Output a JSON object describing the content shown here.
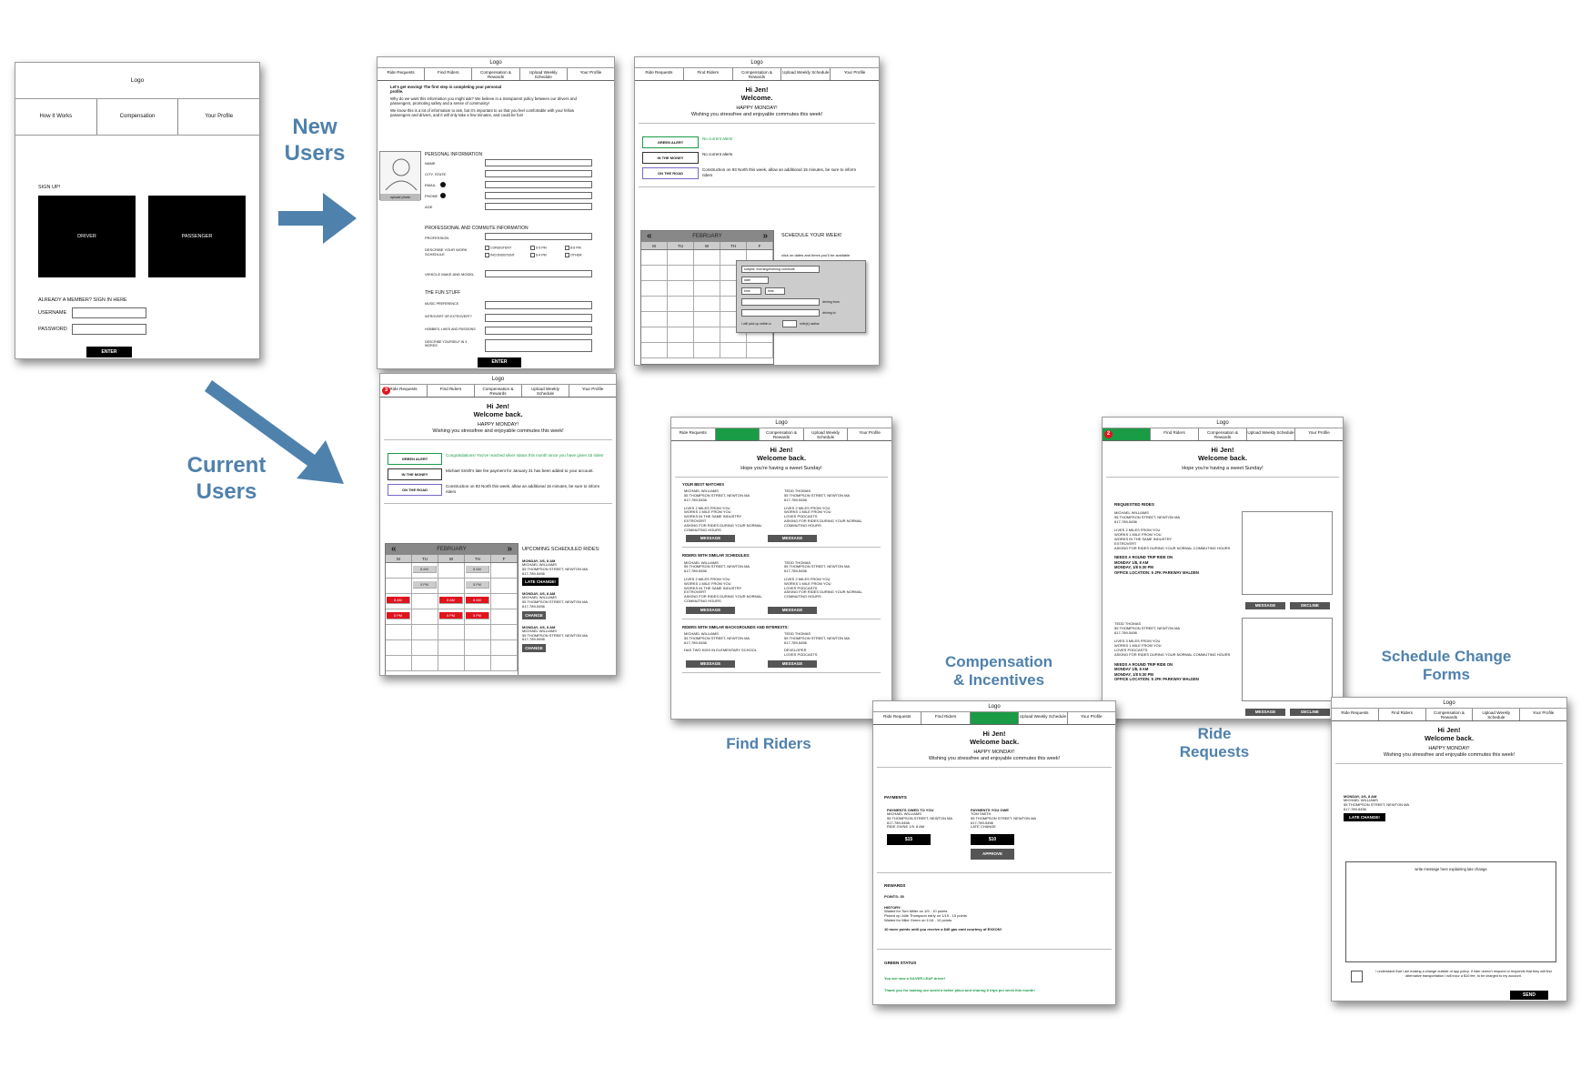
{
  "labels": {
    "new_users": "New Users",
    "current_users": "Current Users",
    "find_riders": "Find Riders",
    "compensation": "Compensation & Incentives",
    "ride_requests": "Ride Requests",
    "schedule_change": "Schedule Change Forms"
  },
  "colors": {
    "arrow": "#4f81ad",
    "label": "#4f81ad",
    "active_tab": "#1a9b45",
    "alert_red": "#e0141e"
  },
  "common": {
    "logo": "Logo",
    "nav": [
      "Ride Requests",
      "Find Riders",
      "Compensation & Rewards",
      "Upload Weekly Schedule",
      "Your Profile"
    ],
    "hi": "Hi Jen!",
    "welcome": "Welcome.",
    "welcome_back": "Welcome back.",
    "happy_monday": "HAPPY MONDAY!",
    "wishing": "Wishing you  stressfree and enjoyable commutes this week!",
    "sweet_sunday": "Hope you're having a sweet Sunday!",
    "month": "FEBRUARY",
    "days": [
      "M",
      "TU",
      "W",
      "TH",
      "F"
    ],
    "message": "MESSAGE",
    "bullet_prev": "«",
    "bullet_next": "»"
  },
  "landing": {
    "logo": "Logo",
    "nav": [
      "How It Works",
      "Compensation",
      "Your Profile"
    ],
    "signup": "SIGN UP!",
    "driver": "DRIVER",
    "passenger": "PASSENGER",
    "already": "ALREADY A MEMBER? SIGN IN HERE",
    "username": "USERNAME",
    "password": "PASSWORD",
    "enter": "ENTER"
  },
  "profile_form": {
    "intro_bold": "Let's get moving! The first step is completing your personal profile.",
    "intro1": "Why do we want this information you might ask? We believe in a transparent policy between our drivers and passengers, promoting safety and a sense of community!",
    "intro2": "We know this is a lot of information to ask, but it's important to us that you feel comfortable with your fellow passengers and drivers, and it will only take a few minutes, and could be fun!",
    "upload_photo": "upload photo",
    "personal": "PERSONAL INFORMATION",
    "personal_fields": [
      "NAME",
      "CITY, STATE",
      "EMAIL",
      "PHONE",
      "AGE"
    ],
    "professional": "PROFESSIONAL AND COMMUTE INFORMATION",
    "profession": "PROFESSION",
    "describe_schedule": "DESCRIBE YOUR WORK SCHEDULE",
    "checks": [
      "CONSISTENT",
      "6-5 PM",
      "8-6 PM",
      "INCONSISTENT",
      "6-4 PM",
      "OTHER"
    ],
    "vehicle": "VEHICLE MAKE AND MODEL",
    "fun": "THE FUN STUFF",
    "fun_fields": [
      "MUSIC PREFERENCE",
      "INTROVERT OR EXTROVERT?",
      "HOBBIES, LIKES AND PASSIONS",
      "DESCRIBE YOURSELF IN 3 WORDS"
    ],
    "enter": "ENTER"
  },
  "welcome_new": {
    "alerts": [
      {
        "box": "GREEN ALERT",
        "text": "No current alerts"
      },
      {
        "box": "IN THE MONEY",
        "text": "No current alerts"
      },
      {
        "box": "ON THE ROAD",
        "text": "Construction on 93 North this week, allow an additional 15 minutes, be sure to inform riders"
      }
    ],
    "schedule_title": "SCHEDULE YOUR WEEK!",
    "schedule_hint": "click on dates and times you'll be available",
    "popup": {
      "subject": "subject: morning/evening commute",
      "date": "date",
      "time1": "time",
      "time2": "time",
      "driving_from": "driving from",
      "driving_to": "driving to",
      "pickup": "I will pick up within a",
      "radius": "mile(s) radius"
    }
  },
  "welcome_current": {
    "badge": "3",
    "alerts": [
      {
        "box": "GREEN ALERT",
        "text": "Congratulations! You've reached silver status this month since you have given 15 rides!"
      },
      {
        "box": "IN THE MONEY",
        "text": "Michael Smith's late fee payment for January 31 has been added to your account."
      },
      {
        "box": "ON THE ROAD",
        "text": "Construction on 93 North this week, allow an additional 15 minutes, be sure to inform riders"
      }
    ],
    "upcoming": "UPCOMING SCHEDULED RIDES:",
    "rides": [
      {
        "when": "MONDAY, 2/6, 8 AM",
        "name": "MICHAEL WILLIAMS",
        "addr": "55 THOMPSON STREET, NEWTON MA",
        "phone": "617-789-5456",
        "button": "LATE CHANGE!"
      },
      {
        "when": "MONDAY, 2/6, 8 AM",
        "name": "MICHAEL WILLIAMS",
        "addr": "55 THOMPSON STREET, NEWTON MA",
        "phone": "617-789-5456",
        "button": "CHANGE"
      },
      {
        "when": "MONDAY, 2/6, 8 AM",
        "name": "MICHAEL WILLIAMS",
        "addr": "55 THOMPSON STREET, NEWTON MA",
        "phone": "617-789-5456",
        "button": "CHANGE"
      }
    ],
    "cal_am": "8 AM",
    "cal_pm": "5 PM"
  },
  "find_riders": {
    "sections": [
      "YOUR BEST MATCHES",
      "RIDERS WITH SIMILAR SCHEDULES:",
      "RIDERS WITH SIMILAR BACKGROUNDS AND INTERESTS:"
    ],
    "p1": {
      "name": "MICHAEL WILLIAMS",
      "addr": "55 THOMPSON STREET, NEWTON MA",
      "phone": "617-789-5456",
      "lines": [
        "LIVES 2 MILES FROM YOU",
        "WORKS 1 MILE FROM YOU",
        "WORKS IN THE SAME INDUSTRY",
        "EXTROVERT",
        "ASKING FOR RIDES DURING YOUR NORMAL COMMUTING HOURS"
      ]
    },
    "p2": {
      "name": "TEDD THOMAS",
      "addr": "55 THOMPSON STREET, NEWTON MA",
      "phone": "617-789-5456",
      "lines": [
        "LIVES 2 MILES FROM YOU",
        "WORKS 1 MILE FROM YOU",
        "LOVES PODCASTS",
        "ASKING FOR RIDES DURING YOUR NORMAL COMMUTING HOURS"
      ]
    },
    "b1": [
      "HAS TWO KIDS IN ELEMENTARY SCHOOL"
    ],
    "b2": [
      "DEVELOPER",
      "LOVES PODCASTS"
    ]
  },
  "ride_requests": {
    "badge": "2",
    "title": "REQUESTED RIDES",
    "r1": {
      "name": "MICHAEL WILLIAMS",
      "addr": "55 THOMPSON STREET, NEWTON MA",
      "phone": "617-789-5456",
      "lines": [
        "LIVES 2 MILES FROM YOU",
        "WORKS 1 MILE FROM YOU",
        "WORKS IN THE SAME INDUSTRY",
        "EXTROVERT",
        "ASKING FOR RIDES DURING YOUR NORMAL COMMUTING HOURS"
      ],
      "need": [
        "NEEDS A ROUND TRIP RIDE ON",
        "MONDAY 1/8, 8 AM",
        "MONDAY, 1/8 5:30 PM",
        "OFFICE LOCATION: 5 JFK PARKWAY MALDEN"
      ]
    },
    "r2": {
      "name": "TEDD THOMAS",
      "addr": "55 THOMPSON STREET, NEWTON MA",
      "phone": "617-789-5456",
      "lines": [
        "LIVES 3 MILES FROM YOU",
        "WORKS 1 MILE FROM YOU",
        "LOVES PODCASTS",
        "ASKING FOR RIDES DURING YOUR NORMAL COMMUTING HOURS"
      ],
      "need": [
        "NEEDS A ROUND TRIP RIDE ON",
        "MONDAY 1/8, 8 AM",
        "MONDAY, 1/8 5:30 PM",
        "OFFICE LOCATION: 5 JFK PARKWAY MALDEN"
      ]
    },
    "message": "MESSAGE",
    "decline": "DECLINE"
  },
  "compensation": {
    "payments": "PAYMENTS",
    "owed_to": {
      "title": "PAYMENTS OWED TO YOU",
      "name": "MICHAEL WILLIAMS",
      "addr": "55 THOMPSON STREET, NEWTON MA",
      "phone": "617-789-5456",
      "extra": "RIDE GIVNE 1/9, 8 AM",
      "amount": "$15"
    },
    "you_owe": {
      "title": "PAYMENTS YOU OWE",
      "name": "TOM SMITH",
      "addr": "55 THOMPSON STREET, NEWTON MA",
      "phone": "617-789-5456",
      "extra": "LATE CHANGE",
      "amount": "$10",
      "approve": "APPROVE"
    },
    "rewards": "REWARDS",
    "points": "POINTS: 35",
    "history": "HISTORY:",
    "history_items": [
      "Waited for Tom Miller on 1/9 - 10 points",
      "Picked up Julie Thompson early on 1/15 - 15 points",
      "Waited for Mike Green on 1/16 - 10 points"
    ],
    "more": "10 more points until you receive a $40 gas card courtesy of EXXON!",
    "green_status": "GREEN STATUS",
    "silver": "You are now a SILVER LEAF driver!",
    "thanks": "Thank you for making our world a better place and sharing 8 trips per week this month!"
  },
  "schedule_change": {
    "when": "MONDAY, 2/6, 8 AM",
    "name": "MICHAEL WILLIAMS",
    "addr": "55 THOMPSON STREET, NEWTON MA",
    "phone": "617-789-5456",
    "late": "LATE CHANGE!",
    "placeholder": "write message here explaining late change",
    "understand": "I understand that I am making a change outside of app policy. If rider doesn't respond or responds that they will find alternative transportation I will incur a $10 fee, to be charged to my account.",
    "send": "SEND"
  }
}
